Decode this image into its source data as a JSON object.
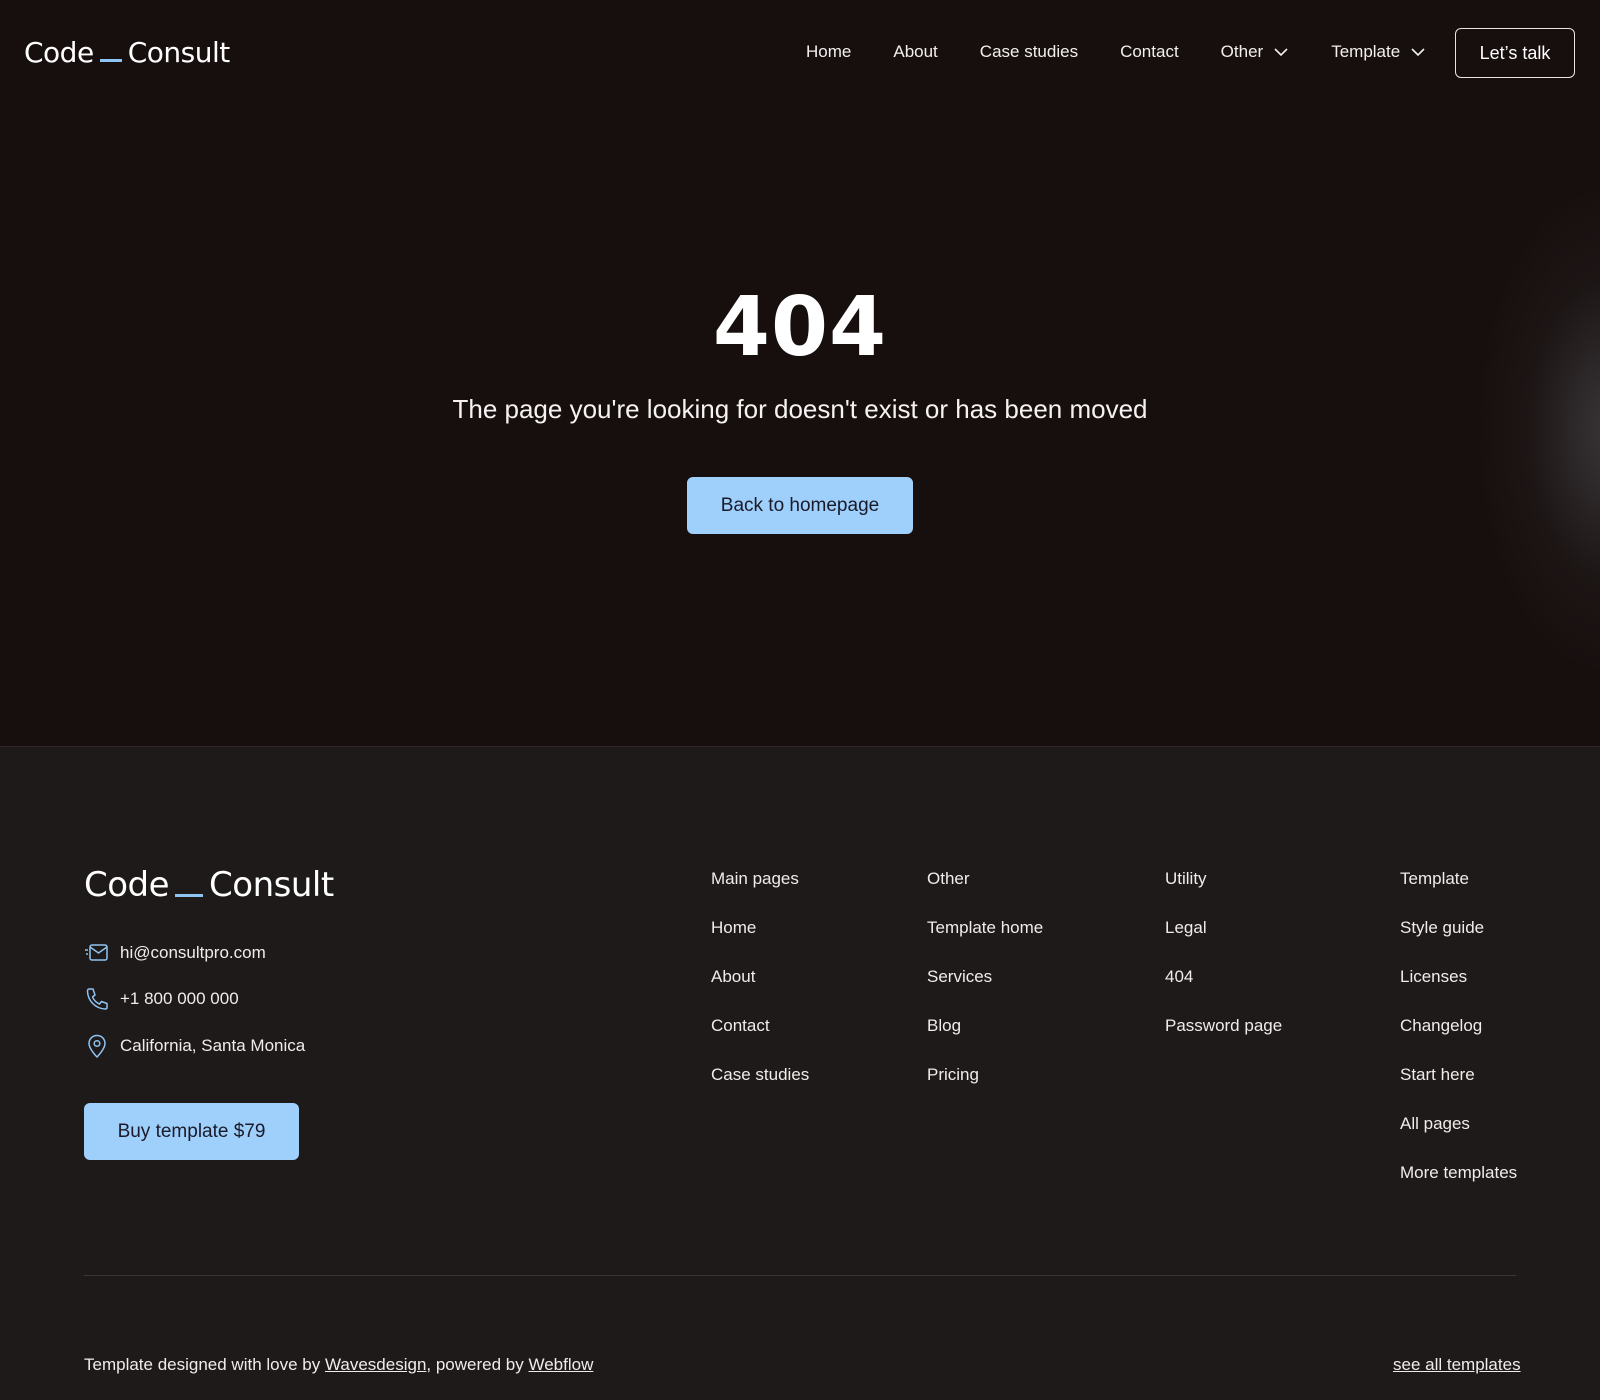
{
  "brand": {
    "part1": "Code",
    "part2": "Consult",
    "accent": "#8fc4f2"
  },
  "nav": {
    "links": [
      {
        "label": "Home"
      },
      {
        "label": "About"
      },
      {
        "label": "Case studies"
      },
      {
        "label": "Contact"
      },
      {
        "label": "Other",
        "dropdown": true
      },
      {
        "label": "Template",
        "dropdown": true
      }
    ],
    "cta": "Let’s talk"
  },
  "hero": {
    "code": "404",
    "message": "The page you're looking for doesn't exist or has been moved",
    "button": "Back to homepage"
  },
  "footer": {
    "email": "hi@consultpro.com",
    "phone": "+1 800 000 000",
    "location": "California, Santa Monica",
    "buy_button": "Buy template $79",
    "columns": [
      {
        "title": "Main pages",
        "links": [
          "Home",
          "About",
          "Contact",
          "Case studies"
        ]
      },
      {
        "title": "Other",
        "links": [
          "Template home",
          "Services",
          "Blog",
          "Pricing"
        ]
      },
      {
        "title": "Utility",
        "links": [
          "Legal",
          "404",
          "Password page"
        ]
      },
      {
        "title": "Template",
        "links": [
          "Style guide",
          "Licenses",
          "Changelog",
          "Start here",
          "All pages",
          "More templates"
        ]
      }
    ],
    "credits": {
      "prefix": "Template designed with love by ",
      "designer": "Wavesdesign",
      "middle": ", powered by ",
      "platform": "Webflow"
    },
    "see_all": "see all templates"
  },
  "colors": {
    "background": "#170f0e",
    "footer_background": "#1e1a19",
    "button": "#9fd0fb"
  }
}
